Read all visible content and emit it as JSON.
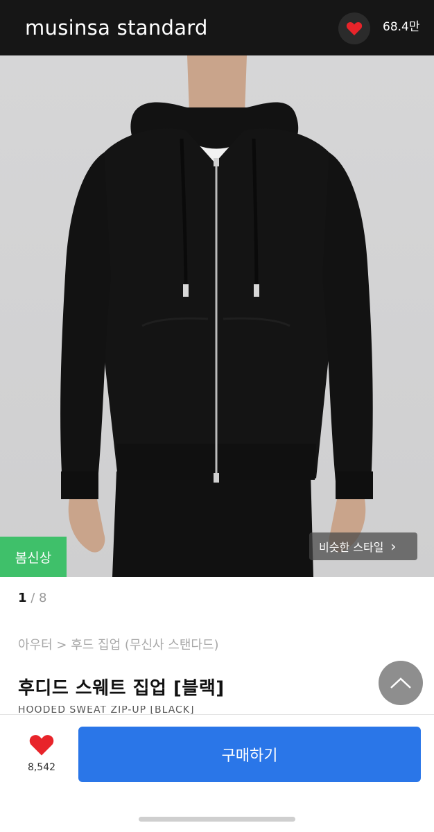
{
  "header": {
    "brand": "musinsa standard",
    "like_count": "68.4만",
    "like_icon": "heart-icon",
    "colors": {
      "background": "#161616",
      "heart": "#e8242a"
    }
  },
  "hero": {
    "image_description": "model-wearing-black-hooded-zip-up",
    "badge": "봄신상",
    "badge_color": "#3fc06a",
    "similar_style": "비슷한 스타일",
    "similar_chevron": "›"
  },
  "product": {
    "pager_current": "1",
    "pager_sep": " / ",
    "pager_total": "8",
    "breadcrumb": "아우터 > 후드 집업 (무신사 스탠다드)",
    "title": "후디드 스웨트 집업 [블랙]",
    "subtitle": "HOODED SWEAT ZIP-UP [BLACK]"
  },
  "bottom_bar": {
    "like_count": "8,542",
    "buy_label": "구매하기",
    "buy_color": "#2a76e8"
  }
}
